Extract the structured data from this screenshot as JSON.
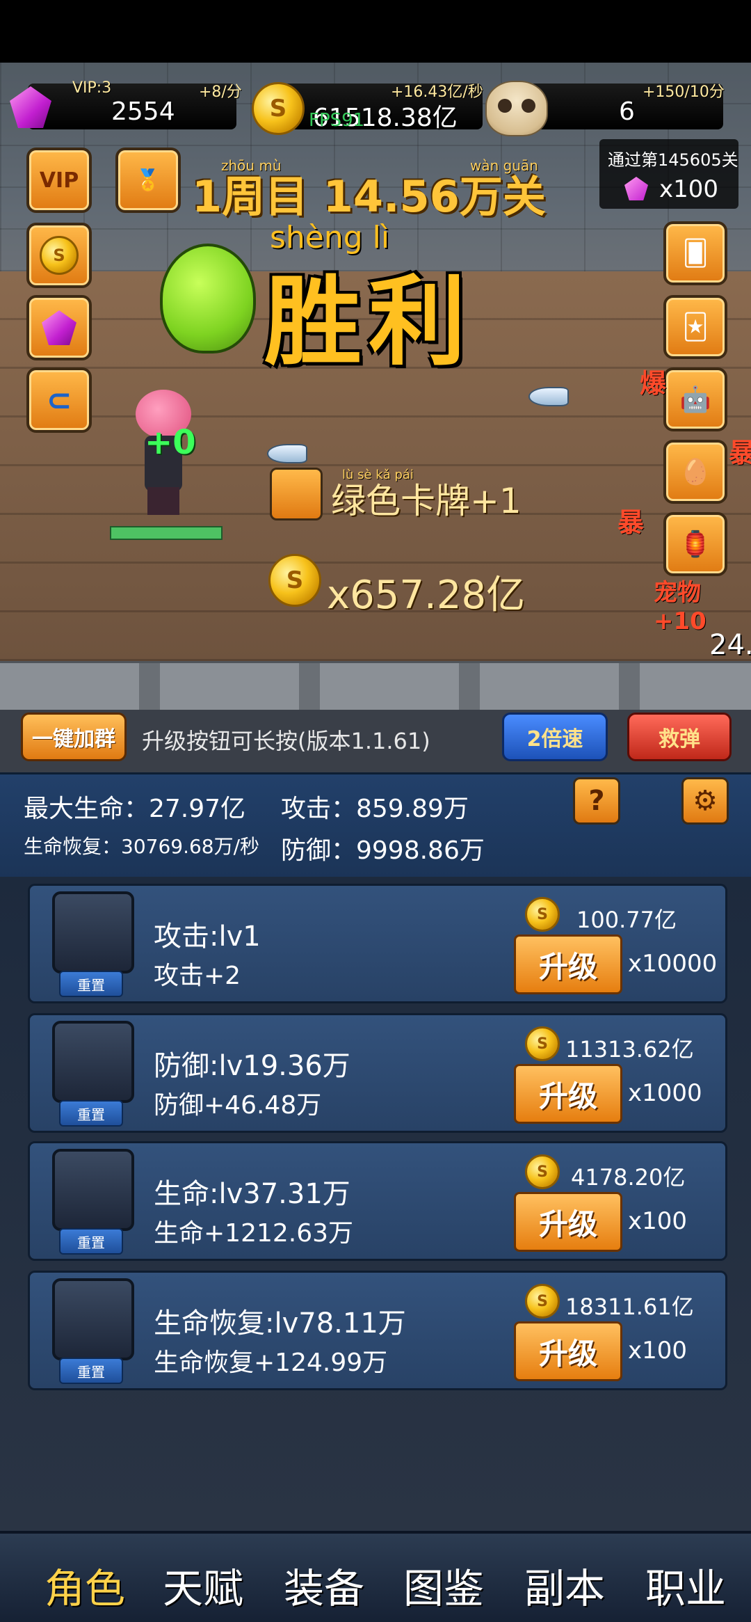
{
  "resources": {
    "vip_label": "VIP:3",
    "gem_rate": "+8/分",
    "gem_amount": "2554",
    "gold_rate": "+16.43亿/秒",
    "gold_amount": "61518.38亿",
    "skull_rate": "+150/10分",
    "skull_amount": "6"
  },
  "fps_text": "FPS91",
  "stage": {
    "cycle_text": "1周目 14.56万关",
    "pass_text": "通过第145605关",
    "pass_reward": "x100",
    "victory_text": "胜利"
  },
  "ruby": {
    "zhou_mu": "zhōu   mù",
    "wan_guan": "wàn guān",
    "sheng_li": "shèng   lì"
  },
  "hero": {
    "plus_text": "+0"
  },
  "rewards": {
    "card_text": "绿色卡牌+1",
    "gold_text": "x657.28亿"
  },
  "floating_damage": [
    "爆",
    "暴",
    "暴",
    "宠物+10"
  ],
  "timer_text": "24.",
  "actions": {
    "join_group": "一键加群",
    "tip": "升级按钮可长按(版本1.1.61)",
    "speed": "2倍速",
    "bomb": "救弹"
  },
  "stats": {
    "max_hp": "最大生命：27.97亿",
    "attack": "攻击：859.89万",
    "hp_regen": "生命恢复：30769.68万/秒",
    "defense": "防御：9998.86万",
    "help_symbol": "?",
    "settings_symbol": "⚙"
  },
  "upgrades": [
    {
      "name": "攻击:lv1",
      "effect": "攻击+2",
      "cost": "100.77亿",
      "button": "升级",
      "multiplier": "x10000",
      "reset": "重置",
      "icon": "sword-icon"
    },
    {
      "name": "防御:lv19.36万",
      "effect": "防御+46.48万",
      "cost": "11313.62亿",
      "button": "升级",
      "multiplier": "x1000",
      "reset": "重置",
      "icon": "shield-icon"
    },
    {
      "name": "生命:lv37.31万",
      "effect": "生命+1212.63万",
      "cost": "4178.20亿",
      "button": "升级",
      "multiplier": "x100",
      "reset": "重置",
      "icon": "heart-icon"
    },
    {
      "name": "生命恢复:lv78.11万",
      "effect": "生命恢复+124.99万",
      "cost": "18311.61亿",
      "button": "升级",
      "multiplier": "x100",
      "reset": "重置",
      "icon": "potion-icon"
    }
  ],
  "nav": [
    "角色",
    "天赋",
    "装备",
    "图鉴",
    "副本",
    "职业"
  ],
  "left_buttons": {
    "vip": "VIP"
  }
}
